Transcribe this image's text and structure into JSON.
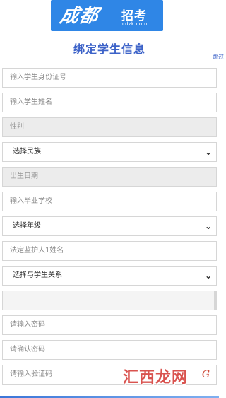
{
  "logo": {
    "script_text": "成都",
    "word_text": "招考",
    "url_text": "cdzk.com"
  },
  "page": {
    "title": "绑定学生信息",
    "skip_label": "跳过"
  },
  "form": {
    "id_number_placeholder": "输入学生身份证号",
    "name_placeholder": "输入学生姓名",
    "gender_value": "性别",
    "ethnicity_value": "选择民族",
    "birthdate_value": "出生日期",
    "school_placeholder": "输入毕业学校",
    "grade_value": "选择年级",
    "guardian_name_placeholder": "法定监护人1姓名",
    "relation_value": "选择与学生关系",
    "blank_value": "",
    "password_placeholder": "请输入密码",
    "confirm_password_placeholder": "请确认密码",
    "verify_code_placeholder": "请输入验证码",
    "captcha_text": "G"
  },
  "watermark": {
    "text": "汇西龙网"
  },
  "icons": {
    "dropdown": "chevron-down-icon"
  },
  "colors": {
    "brand_blue": "#2f86e6",
    "title_blue": "#3c62c8",
    "border_gray": "#d6d6d6",
    "disabled_gray": "#ececec"
  }
}
